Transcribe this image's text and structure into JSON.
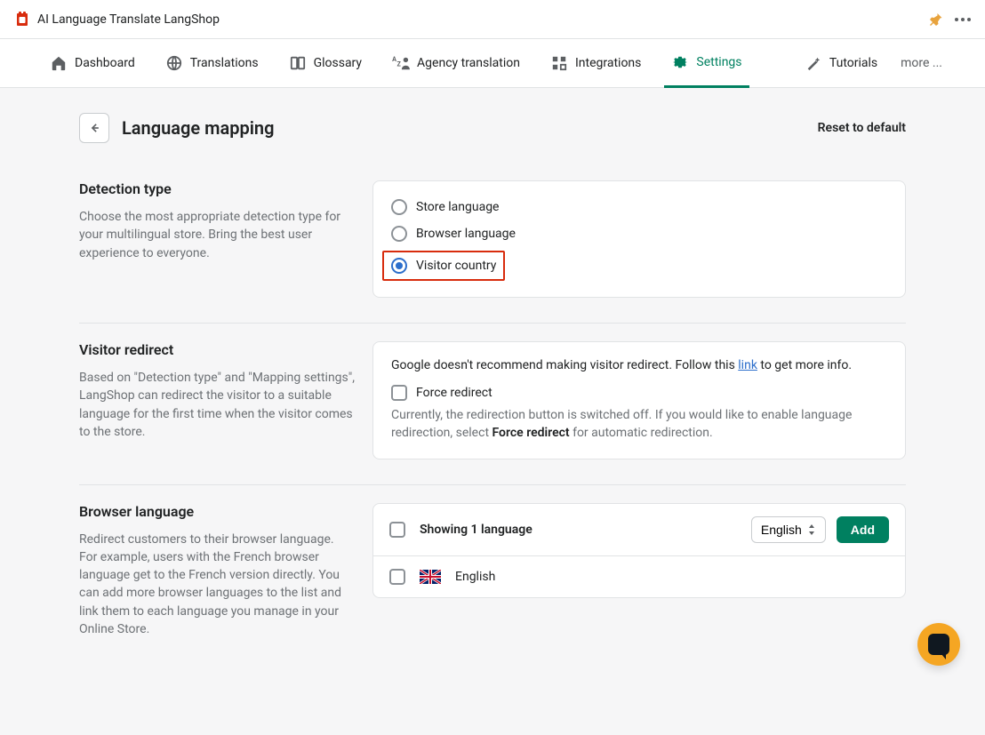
{
  "app": {
    "title": "AI Language Translate LangShop"
  },
  "nav": {
    "tabs": [
      {
        "label": "Dashboard"
      },
      {
        "label": "Translations"
      },
      {
        "label": "Glossary"
      },
      {
        "label": "Agency translation"
      },
      {
        "label": "Integrations"
      },
      {
        "label": "Settings"
      },
      {
        "label": "Tutorials"
      }
    ],
    "more": "more ..."
  },
  "page": {
    "title": "Language mapping",
    "reset": "Reset to default"
  },
  "detection": {
    "heading": "Detection type",
    "description": "Choose the most appropriate detection type for your multilingual store. Bring the best user experience to everyone.",
    "options": {
      "store": "Store language",
      "browser": "Browser language",
      "visitor": "Visitor country"
    }
  },
  "redirect": {
    "heading": "Visitor redirect",
    "description": "Based on \"Detection type\" and \"Mapping settings\", LangShop can redirect the visitor to a suitable language for the first time when the visitor comes to the store.",
    "note_pre": "Google doesn't recommend making visitor redirect. Follow this ",
    "note_link": "link",
    "note_post": " to get more info.",
    "checkbox_label": "Force redirect",
    "helper_pre": "Currently, the redirection button is switched off. If you would like to enable language redirection, select ",
    "helper_bold": "Force redirect",
    "helper_post": " for automatic redirection."
  },
  "browser_lang": {
    "heading": "Browser language",
    "description": "Redirect customers to their browser language. For example, users with the French browser language get to the French version directly. You can add more browser languages to the list and link them to each language you manage in your Online Store.",
    "showing": "Showing 1 language",
    "select_value": "English",
    "add": "Add",
    "rows": [
      {
        "name": "English"
      }
    ]
  }
}
